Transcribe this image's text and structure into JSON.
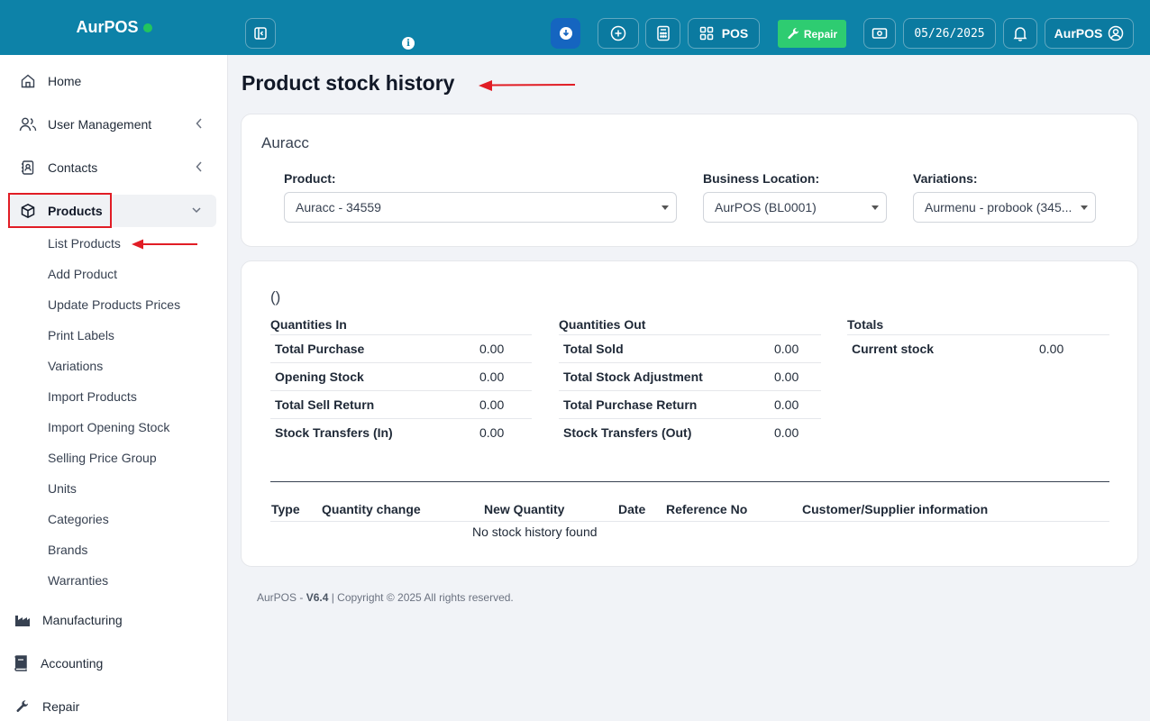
{
  "app": {
    "brand": "AurPOS"
  },
  "topbar": {
    "pos_label": "POS",
    "repair_label": "Repair",
    "date": "05/26/2025",
    "user": "AurPOS",
    "colors": {
      "bar": "#0d82a8",
      "repair": "#2ecc71",
      "active_btn": "#1565c0"
    }
  },
  "sidebar": {
    "items": [
      {
        "label": "Home",
        "icon": "home-icon"
      },
      {
        "label": "User Management",
        "icon": "users-icon"
      },
      {
        "label": "Contacts",
        "icon": "contacts-icon"
      },
      {
        "label": "Products",
        "icon": "cube-icon"
      },
      {
        "label": "Manufacturing",
        "icon": "factory-icon"
      },
      {
        "label": "Accounting",
        "icon": "book-icon"
      },
      {
        "label": "Repair",
        "icon": "wrench-icon"
      }
    ],
    "products_sub": [
      "List Products",
      "Add Product",
      "Update Products Prices",
      "Print Labels",
      "Variations",
      "Import Products",
      "Import Opening Stock",
      "Selling Price Group",
      "Units",
      "Categories",
      "Brands",
      "Warranties"
    ]
  },
  "page": {
    "title": "Product stock history"
  },
  "filters": {
    "card_title": "Auracc",
    "product_label": "Product:",
    "product_value": "Auracc - 34559",
    "location_label": "Business Location:",
    "location_value": "AurPOS (BL0001)",
    "variations_label": "Variations:",
    "variations_value": "Aurmenu - probook (345..."
  },
  "summary": {
    "subtitle": "()",
    "in": {
      "heading": "Quantities In",
      "rows": [
        {
          "label": "Total Purchase",
          "value": "0.00"
        },
        {
          "label": "Opening Stock",
          "value": "0.00"
        },
        {
          "label": "Total Sell Return",
          "value": "0.00"
        },
        {
          "label": "Stock Transfers (In)",
          "value": "0.00"
        }
      ]
    },
    "out": {
      "heading": "Quantities Out",
      "rows": [
        {
          "label": "Total Sold",
          "value": "0.00"
        },
        {
          "label": "Total Stock Adjustment",
          "value": "0.00"
        },
        {
          "label": "Total Purchase Return",
          "value": "0.00"
        },
        {
          "label": "Stock Transfers (Out)",
          "value": "0.00"
        }
      ]
    },
    "totals": {
      "heading": "Totals",
      "rows": [
        {
          "label": "Current stock",
          "value": "0.00"
        }
      ]
    }
  },
  "history_table": {
    "columns": [
      "Type",
      "Quantity change",
      "New Quantity",
      "Date",
      "Reference No",
      "Customer/Supplier information"
    ],
    "empty": "No stock history found"
  },
  "footer": {
    "brand": "AurPOS - ",
    "version": "V6.4",
    "copyright": " | Copyright © 2025 All rights reserved."
  }
}
